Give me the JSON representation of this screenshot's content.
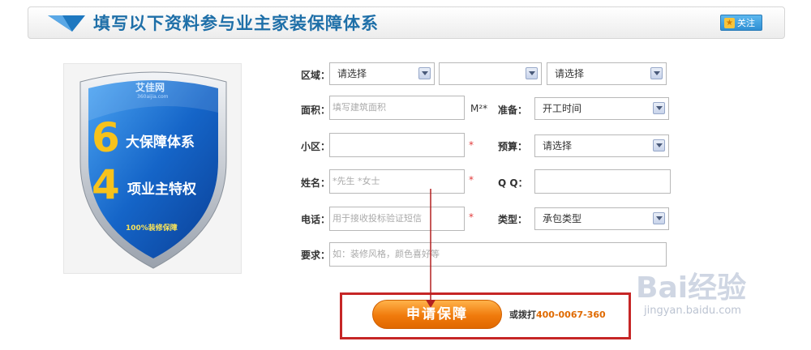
{
  "header": {
    "title": "填写以下资料参与业主家装保障体系",
    "follow_label": "关注"
  },
  "badge": {
    "brand": "艾佳网",
    "brand_url": "360aijia.com",
    "number1": "6",
    "line1": "大保障体系",
    "number2": "4",
    "line2": "项业主特权",
    "guarantee": "100%装修保障"
  },
  "form": {
    "region": {
      "label": "区域：",
      "select1": "请选择",
      "select2": "",
      "select3": "请选择"
    },
    "area": {
      "label": "面积：",
      "placeholder": "填写建筑面积",
      "unit": "M²*"
    },
    "prepare": {
      "label": "准备：",
      "value": "开工时间"
    },
    "community": {
      "label": "小区：",
      "value": "",
      "required": "*"
    },
    "budget": {
      "label": "预算：",
      "value": "请选择"
    },
    "name": {
      "label": "姓名：",
      "placeholder": "*先生  *女士",
      "required": "*"
    },
    "qq": {
      "label": "Q  Q：",
      "value": ""
    },
    "phone": {
      "label": "电话：",
      "placeholder": "用于接收投标验证短信",
      "required": "*"
    },
    "type": {
      "label": "类型：",
      "value": "承包类型"
    },
    "requirement": {
      "label": "要求：",
      "placeholder": "如：装修风格，颜色喜好等"
    }
  },
  "submit": {
    "label": "申请保障",
    "call_prefix": "或拨打",
    "phone": "400-0067-360"
  },
  "watermark": {
    "logo": "Bai经验",
    "url": "jingyan.baidu.com"
  },
  "colors": {
    "title": "#1e6fa8",
    "accent": "#f07a0c",
    "annotation": "#c62626"
  }
}
